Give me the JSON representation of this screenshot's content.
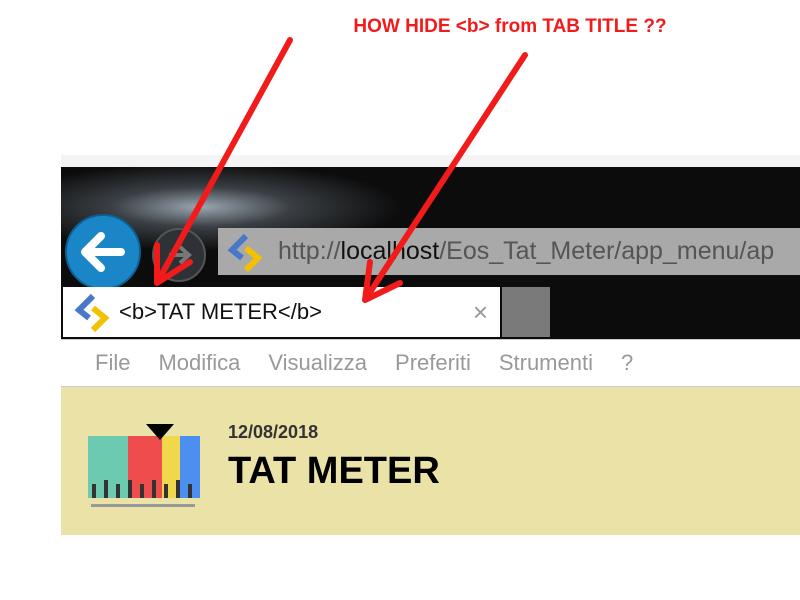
{
  "annotation": {
    "question": "HOW HIDE <b> from TAB TITLE ??",
    "color": "#f21b1b"
  },
  "browser": {
    "address": {
      "prefix": "http://",
      "host": "localhost",
      "path": "/Eos_Tat_Meter/app_menu/ap"
    },
    "tab": {
      "title": "<b>TAT METER</b>",
      "close": "×"
    },
    "menu": [
      "File",
      "Modifica",
      "Visualizza",
      "Preferiti",
      "Strumenti",
      "?"
    ]
  },
  "page": {
    "date": "12/08/2018",
    "title": "TAT METER",
    "background": "#ebe2a8"
  }
}
